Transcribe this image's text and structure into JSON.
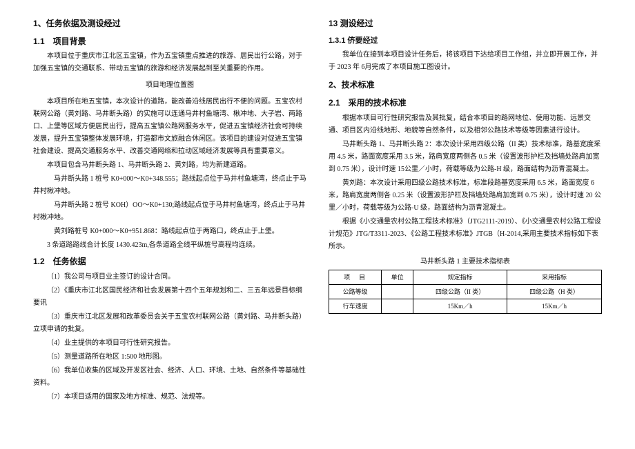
{
  "left": {
    "sec1": "1、任务依据及测设经过",
    "sec1_1": "1.1　项目背景",
    "p1": "本项目位于重庆市江北区五宝镇，作为五宝镇重点推进的旅游、居民出行公路，对于加强五宝镇的交通联系、带动五宝镇的旅游和经济发展起到至关重要的作用。",
    "figcap": "项目地理位置图",
    "p2": "本项目所在地五宝镇，本次设计的道路，能改善沿线居民出行不便的问题。五宝农村联网公路（黄刘路、马井断头路）的实施可以连通马井村鱼塘湾、楸冲地、大子岩、两路口、上堡等区域方便居民出行，提高五宝镇公路网服务水平，促进五宝镇经济社会可持续发展，提升五宝镇整体发展环境，打造都市文旅融合休闲区。该项目的建设对促进五宝镇社会建设、提高交通服务水平、改善交通网络和拉动区域经济发展等具有重要意义。",
    "p3": "本项目包含马井断头路 1、马井断头路 2、黄刘路，均为新建道路。",
    "p4": "马井断头路 1 桩号 K0+000～K0+348.555；路线起点位于马井村鱼塘湾，终点止于马井村楸冲地。",
    "p5": "马井断头路 2 桩号 KOH）OO～K0+130;路线起点位于马井村鱼塘湾，终点止于马井村楸冲地。",
    "p6": "黄刘路桩号 K0+000～K0+951.868：路线起点位于两路口，终点止于上堡。",
    "p8": "3 条道路路线合计长度 1430.423m,各条道路全线平纵桩号高程均连续。",
    "sec1_2": "1.2　任务依据",
    "li1": "（1）我公司与项目业主签订的设计合同。",
    "li2": "（2）《重庆市江北区国民经济和社会发展第十四个五年规划和二、三五年远景目标纲要讯",
    "li3": "（3）重庆市江北区发展和改革委员会关于五宝农村联网公路（黄刘路、马井断头路）立项申请的批复。",
    "li4": "（4）业主提供的本项目可行性研究报告。",
    "li5": "（5）测量道路所在地区 1:500 地形图。",
    "li6": "（6）我单位收集的区域及开发区社会、经济、人口、环境、土地、自然条件等基础性资料。",
    "li7": "（7）本项目适用的国家及地方标准、规范、法规等。"
  },
  "right": {
    "sec13": "13 测设经过",
    "sec131": "1.3.1 侪要经过",
    "p1": "我单位在接到本项目设计任务后，将该项目下达给项目工作组，并立即开展工作，并于 2023 年 6月完成了本项目施工图设计。",
    "sec2": "2、技术标准",
    "sec21": "2.1　采用的技术标准",
    "p2": "根据本项目可行性研究报告及其批复，结合本项目的路网地位、使用功能、远景交通、项目区内沿线地形、地貌等自然条件，以及相邻公路技术等级等因素进行设计。",
    "p3": "马井断头路 1、马井断头路 2：本次设计采用四级公路（II 类）技术标准，路基宽度采用 4.5 米，路面宽度采用 3.5 米，路肩宽度两侧各 0.5 米（设置波形护栏及挡墙处路肩加宽到 0.75 米），设计时速 15公里／小时，荷载等级为公路-H 级，路面结构为沥青混凝土。",
    "p4": "黄刘路：本次设计采用四级公路技术标准，标准段路基宽度采用 6.5 米，路面宽度 6 米，路肩宽度两侧各 0.25 米（设置波形护栏及挡墙处路肩加宽到 0.75 米），设计时速 20 公里／小时，荷载等级为公路-U 级，路面结构为沥青混凝土。",
    "p5": "根据《小交通量农村公路工程技术标准》（JTG2111-2019）、《小交通量农村公路工程设计规范》JTG/T3311-2023、《公路工程技术标准》JTGB（H-2014,采用主要技术指标如下表所示。",
    "tblcap": "马井断头路 1 主要技术指标表",
    "th1": "项　目",
    "th2": "单位",
    "th3": "规定指标",
    "th4": "采用指标",
    "r1c1": "公路等级",
    "r1c2": "",
    "r1c3": "四级公路（II 类）",
    "r1c4": "四级公路（H 类）",
    "r2c1": "行车速度",
    "r2c2": "",
    "r2c3": "15Km／h",
    "r2c4": "15Km／h"
  }
}
